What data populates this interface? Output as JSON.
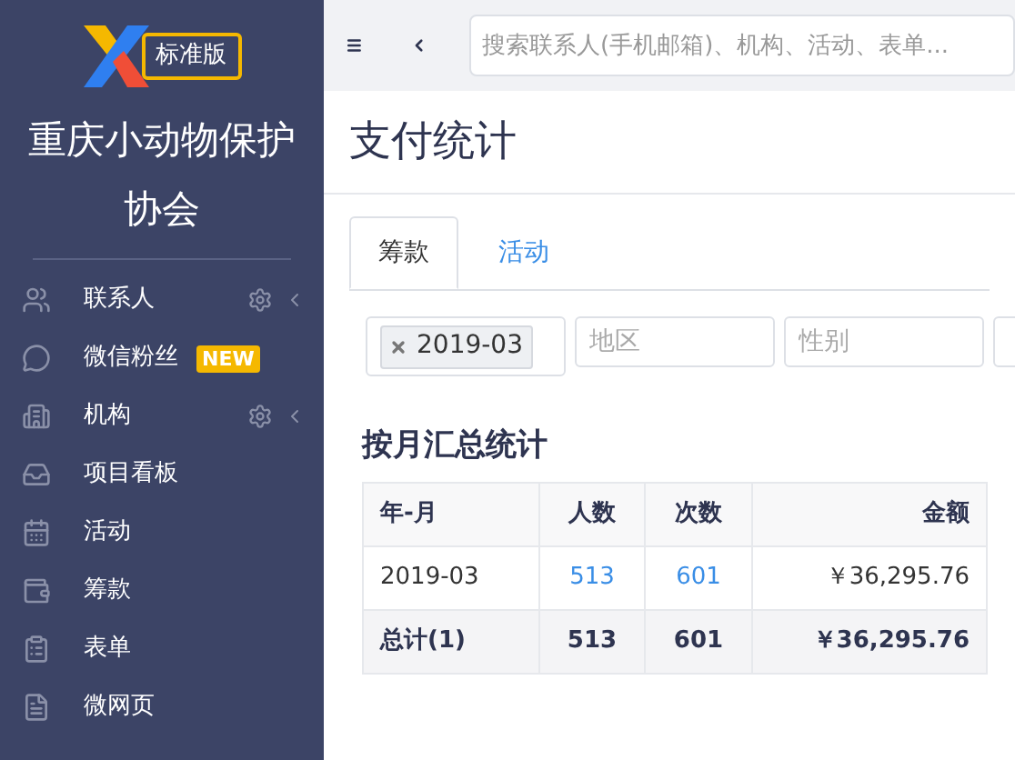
{
  "sidebar": {
    "logo_badge": "标准版",
    "org_name": "重庆小动物保护协会",
    "items": [
      {
        "label": "联系人",
        "settings": true,
        "expandable": true
      },
      {
        "label": "微信粉丝",
        "settings": false,
        "expandable": false,
        "badge": "NEW"
      },
      {
        "label": "机构",
        "settings": true,
        "expandable": true
      },
      {
        "label": "项目看板",
        "settings": false,
        "expandable": false
      },
      {
        "label": "活动",
        "settings": false,
        "expandable": false
      },
      {
        "label": "筹款",
        "settings": false,
        "expandable": false
      },
      {
        "label": "表单",
        "settings": false,
        "expandable": false
      },
      {
        "label": "微网页",
        "settings": false,
        "expandable": false
      }
    ]
  },
  "topbar": {
    "search": {
      "placeholder": "搜索联系人(手机邮箱)、机构、活动、表单..."
    }
  },
  "page_title": "支付统计",
  "tabs": [
    {
      "label": "筹款",
      "selected": true
    },
    {
      "label": "活动",
      "selected": false
    }
  ],
  "filters": [
    {
      "kind": "tags",
      "tags": [
        "2019-03"
      ]
    },
    {
      "kind": "text",
      "placeholder": "地区"
    },
    {
      "kind": "text",
      "placeholder": "性别"
    },
    {
      "kind": "text"
    }
  ],
  "section_title": "按月汇总统计",
  "table": {
    "columns": [
      "年-月",
      "人数",
      "次数",
      "金额"
    ],
    "rows": [
      [
        "2019-03",
        "513",
        "601",
        "￥36,295.76"
      ]
    ],
    "total": [
      "总计(1)",
      "513",
      "601",
      "￥36,295.76"
    ]
  }
}
